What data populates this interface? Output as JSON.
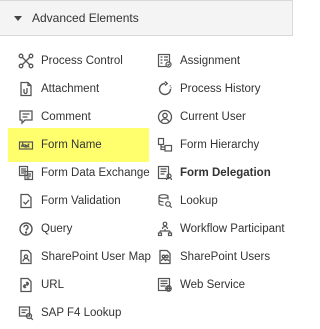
{
  "section": {
    "title": "Advanced Elements"
  },
  "left_items": [
    {
      "label": "Process Control",
      "icon": "process-control-icon"
    },
    {
      "label": "Attachment",
      "icon": "attachment-icon"
    },
    {
      "label": "Comment",
      "icon": "comment-icon"
    },
    {
      "label": "Form Name",
      "icon": "form-name-icon"
    },
    {
      "label": "Form Data Exchange",
      "icon": "form-data-exchange-icon"
    },
    {
      "label": "Form Validation",
      "icon": "form-validation-icon"
    },
    {
      "label": "Query",
      "icon": "query-icon"
    },
    {
      "label": "SharePoint User Map",
      "icon": "sharepoint-user-map-icon"
    },
    {
      "label": "URL",
      "icon": "url-icon"
    },
    {
      "label": "SAP F4 Lookup",
      "icon": "sap-f4-lookup-icon"
    }
  ],
  "right_items": [
    {
      "label": "Assignment",
      "icon": "assignment-icon"
    },
    {
      "label": "Process History",
      "icon": "process-history-icon"
    },
    {
      "label": "Current User",
      "icon": "current-user-icon"
    },
    {
      "label": "Form Hierarchy",
      "icon": "form-hierarchy-icon"
    },
    {
      "label": "Form Delegation",
      "icon": "form-delegation-icon"
    },
    {
      "label": "Lookup",
      "icon": "lookup-icon"
    },
    {
      "label": "Workflow Participant",
      "icon": "workflow-participant-icon"
    },
    {
      "label": "SharePoint Users",
      "icon": "sharepoint-users-icon"
    },
    {
      "label": "Web Service",
      "icon": "web-service-icon"
    }
  ],
  "colors": {
    "highlight": "#ffff6e",
    "header_bg": "#f4f4f4",
    "icon": "#555555"
  }
}
